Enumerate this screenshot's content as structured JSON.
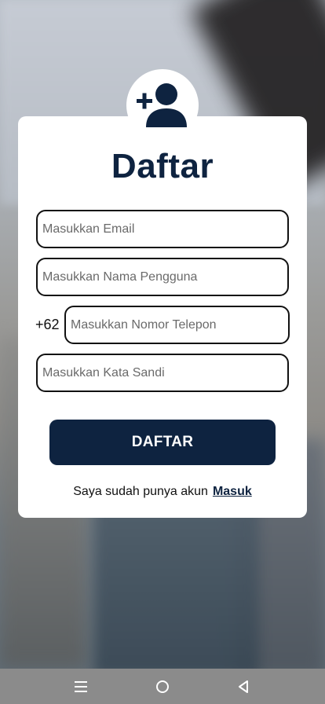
{
  "page": {
    "title": "Daftar"
  },
  "form": {
    "email_placeholder": "Masukkan Email",
    "username_placeholder": "Masukkan Nama Pengguna",
    "phone_prefix": "+62",
    "phone_placeholder": "Masukkan Nomor Telepon",
    "password_placeholder": "Masukkan Kata Sandi",
    "submit_label": "DAFTAR"
  },
  "footer": {
    "have_account_text": "Saya sudah punya akun",
    "login_link": "Masuk"
  },
  "icons": {
    "header": "add-user-icon",
    "nav": [
      "menu-icon",
      "home-icon",
      "back-icon"
    ]
  },
  "colors": {
    "primary": "#0e2340",
    "card": "#ffffff",
    "navbar": "#8b8b8b"
  }
}
